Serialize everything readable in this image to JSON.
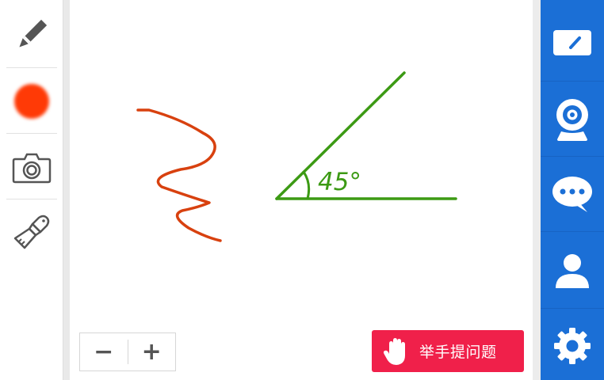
{
  "left_toolbar": {
    "tools": [
      {
        "name": "pencil-icon"
      },
      {
        "name": "color-swatch",
        "color": "#ff3a06"
      },
      {
        "name": "camera-icon"
      },
      {
        "name": "brush-icon"
      }
    ]
  },
  "canvas": {
    "annotation_text": "45°",
    "stroke_colors": {
      "squiggle": "#d8410f",
      "angle": "#3c9a14"
    }
  },
  "zoom": {
    "minus_label": "−",
    "plus_label": "+"
  },
  "raise_hand": {
    "label": "举手提问题",
    "color": "#f0204a"
  },
  "right_sidebar": {
    "color": "#1b6fd6",
    "items": [
      {
        "name": "whiteboard-icon"
      },
      {
        "name": "webcam-icon"
      },
      {
        "name": "chat-icon"
      },
      {
        "name": "user-icon"
      },
      {
        "name": "gear-icon"
      }
    ]
  }
}
